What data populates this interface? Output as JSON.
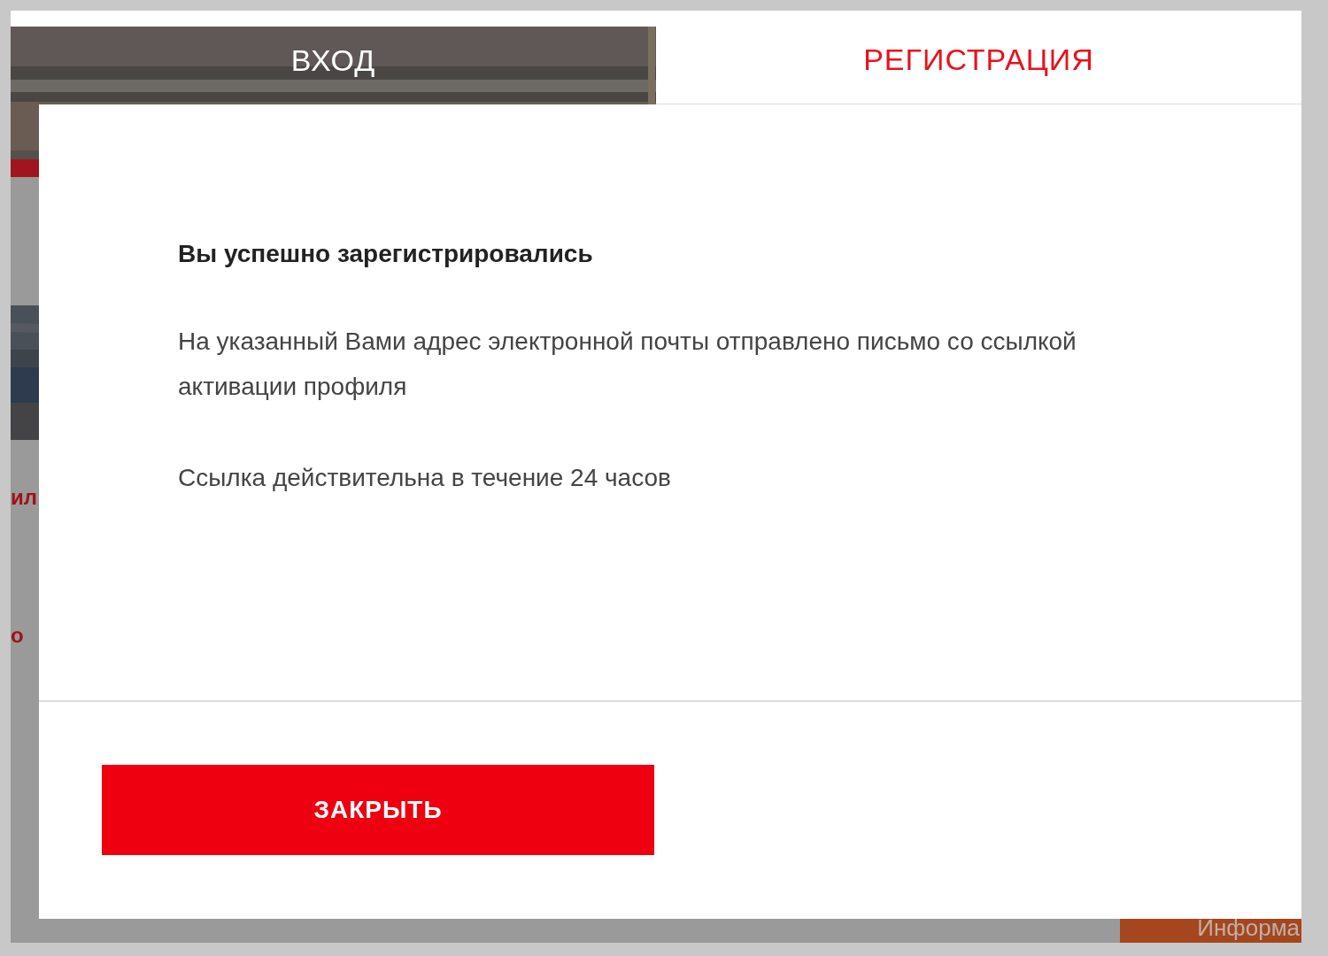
{
  "background": {
    "cut_texts": [
      {
        "text": "ил"
      },
      {
        "text": "о"
      }
    ],
    "info_tile": "Информа"
  },
  "modal": {
    "tabs": [
      {
        "label": "ВХОД",
        "selected": false
      },
      {
        "label": "РЕГИСТРАЦИЯ",
        "selected": true
      }
    ],
    "title": "Вы успешно зарегистрировались",
    "paragraphs": [
      "На указанный Вами адрес электронной почты отправлено письмо со ссылкой активации профиля",
      "Ссылка действительна в течение 24 часов"
    ],
    "button": "ЗАКРЫТЬ"
  }
}
